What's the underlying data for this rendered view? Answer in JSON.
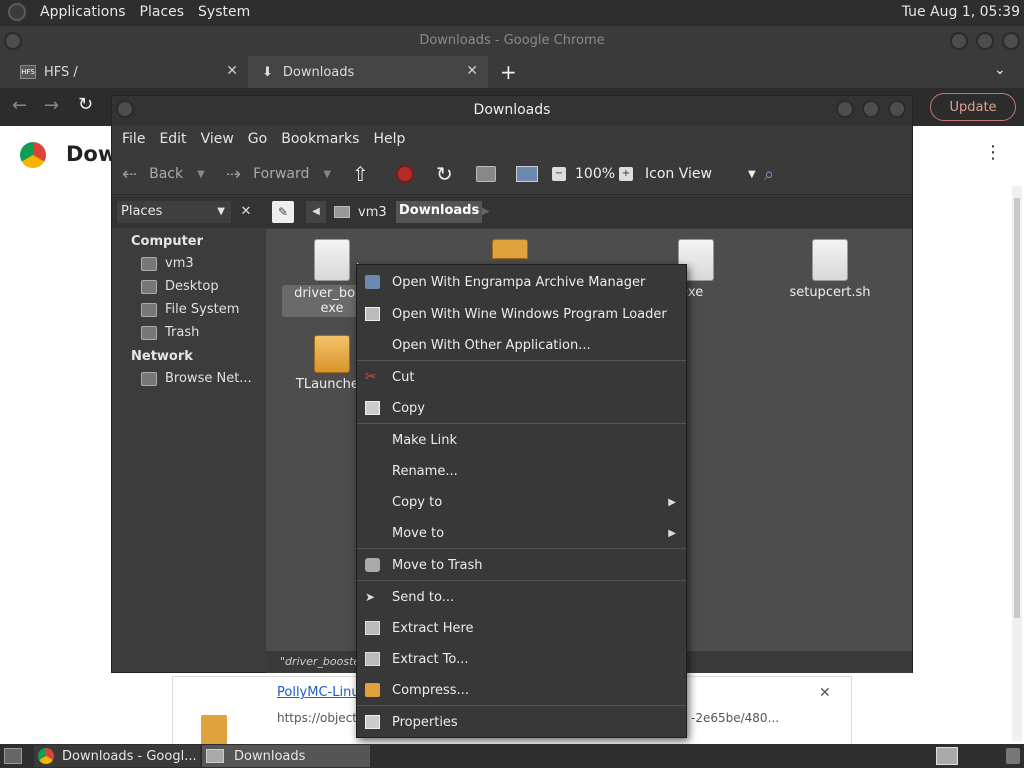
{
  "top_panel": {
    "menus": [
      "Applications",
      "Places",
      "System"
    ],
    "clock": "Tue Aug  1, 05:39"
  },
  "chrome": {
    "window_title": "Downloads - Google Chrome",
    "tabs": [
      {
        "label": "HFS /"
      },
      {
        "label": "Downloads"
      }
    ],
    "update_label": "Update",
    "page_heading_partial": "Dow",
    "download_item": {
      "name": "PollyMC-Linux",
      "url_start": "https://object",
      "url_end": "-2e65be/480..."
    }
  },
  "file_manager": {
    "title": "Downloads",
    "menus": [
      "File",
      "Edit",
      "View",
      "Go",
      "Bookmarks",
      "Help"
    ],
    "toolbar": {
      "back": "Back",
      "forward": "Forward",
      "zoom": "100%",
      "view_mode": "Icon View"
    },
    "places_label": "Places",
    "breadcrumb": [
      "vm3",
      "Downloads"
    ],
    "sidebar": {
      "computer_heading": "Computer",
      "computer_items": [
        "vm3",
        "Desktop",
        "File System",
        "Trash"
      ],
      "network_heading": "Network",
      "network_items": [
        "Browse Net..."
      ]
    },
    "files": [
      {
        "name_line1": "driver_boos",
        "name_line2": "exe"
      },
      {
        "name_line1": ".exe"
      },
      {
        "name_line1": "setupcert.sh"
      },
      {
        "name_line1": "TLauncher-"
      }
    ],
    "status_text": "\"driver_booster"
  },
  "context_menu": {
    "items": [
      "Open With Engrampa Archive Manager",
      "Open With Wine Windows Program Loader",
      "Open With Other Application...",
      "Cut",
      "Copy",
      "Make Link",
      "Rename...",
      "Copy to",
      "Move to",
      "Move to Trash",
      "Send to...",
      "Extract Here",
      "Extract To...",
      "Compress...",
      "Properties"
    ]
  },
  "taskbar": {
    "items": [
      "Downloads - Googl...",
      "Downloads"
    ]
  },
  "colors": {
    "panel_bg": "#2e2e2e",
    "menu_bg": "#383838",
    "folder": "#e0a23c",
    "update_accent": "#c67a6a"
  }
}
